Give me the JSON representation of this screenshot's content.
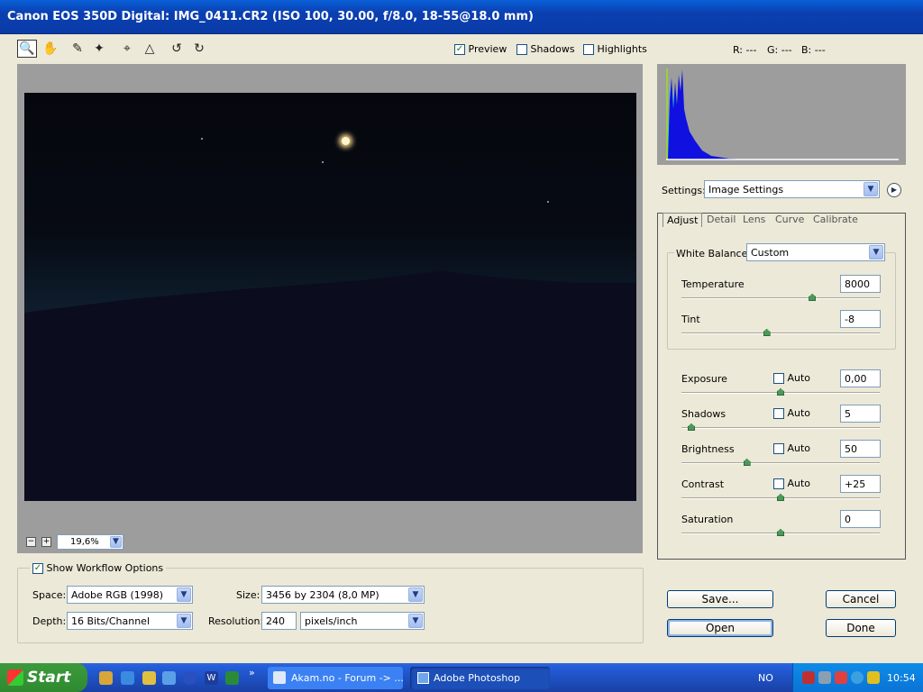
{
  "window": {
    "title": "Canon EOS 350D Digital:  IMG_0411.CR2  (ISO 100, 30.00, f/8.0, 18-55@18.0 mm)"
  },
  "toolbar": {
    "tools": [
      "zoom-tool",
      "hand-tool",
      "white-balance-tool",
      "color-sampler-tool",
      "crop-tool",
      "straighten-tool",
      "rotate-left-tool",
      "rotate-right-tool"
    ],
    "preview_label": "Preview",
    "shadows_label": "Shadows",
    "highlights_label": "Highlights",
    "preview_checked": true,
    "shadows_checked": false,
    "highlights_checked": false
  },
  "rgb_readout": {
    "r": "R: ---",
    "g": "G: ---",
    "b": "B: ---"
  },
  "zoom": {
    "minus": "−",
    "plus": "+",
    "value": "19,6%"
  },
  "workflow": {
    "title": "Show Workflow Options",
    "checked": true,
    "space_label": "Space:",
    "space_value": "Adobe RGB (1998)",
    "size_label": "Size:",
    "size_value": "3456 by 2304  (8,0 MP)",
    "depth_label": "Depth:",
    "depth_value": "16 Bits/Channel",
    "resolution_label": "Resolution:",
    "resolution_value": "240",
    "resolution_unit": "pixels/inch"
  },
  "settings": {
    "label": "Settings:",
    "value": "Image Settings"
  },
  "tabs": [
    {
      "label": "Adjust",
      "active": true
    },
    {
      "label": "Detail",
      "active": false
    },
    {
      "label": "Lens",
      "active": false
    },
    {
      "label": "Curve",
      "active": false
    },
    {
      "label": "Calibrate",
      "active": false
    }
  ],
  "white_balance": {
    "label": "White Balance:",
    "value": "Custom"
  },
  "adjust": {
    "temperature": {
      "label": "Temperature",
      "value": "8000",
      "level": 0.66
    },
    "tint": {
      "label": "Tint",
      "value": "-8",
      "level": 0.43
    },
    "exposure": {
      "label": "Exposure",
      "auto_label": "Auto",
      "value": "0,00",
      "level": 0.5
    },
    "shadows": {
      "label": "Shadows",
      "auto_label": "Auto",
      "value": "5",
      "level": 0.05
    },
    "brightness": {
      "label": "Brightness",
      "auto_label": "Auto",
      "value": "50",
      "level": 0.33
    },
    "contrast": {
      "label": "Contrast",
      "auto_label": "Auto",
      "value": "+25",
      "level": 0.5
    },
    "saturation": {
      "label": "Saturation",
      "value": "0",
      "level": 0.5
    }
  },
  "buttons": {
    "save": "Save...",
    "cancel": "Cancel",
    "open": "Open",
    "done": "Done"
  },
  "taskbar": {
    "start": "Start",
    "overflow": "»",
    "item1": "Akam.no - Forum -> ...",
    "item2": "Adobe Photoshop",
    "lang": "NO",
    "clock": "10:54"
  },
  "colors": {
    "accent": "#0a5fd8",
    "taskbar": "#245edb",
    "start": "#2f8a2f",
    "photo_dark": "#0b0c1d"
  }
}
